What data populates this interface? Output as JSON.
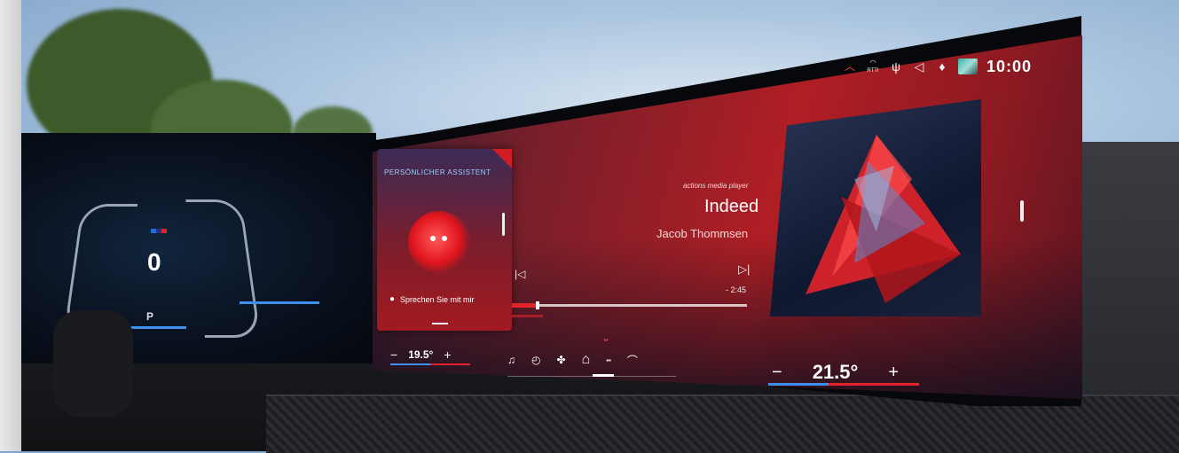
{
  "status_bar": {
    "icons": [
      "chevron-up-icon",
      "signal-icon",
      "charging-icon",
      "volume-icon",
      "microphone-icon",
      "profile-thumbnail"
    ],
    "rtti_label": "RTTI",
    "time": "10:00"
  },
  "cluster": {
    "speed": "0",
    "gear": "P"
  },
  "assistant": {
    "title": "PERSÖNLICHER ASSISTENT",
    "prompt": "Sprechen Sie mit mir"
  },
  "media": {
    "source": "actions media player",
    "title": "Indeed",
    "artist": "Jacob Thommsen",
    "remaining": "- 2:45",
    "progress": 0.1
  },
  "climate": {
    "left_temp": "19.5°",
    "right_temp": "21.5°",
    "minus": "−",
    "plus": "+"
  },
  "nav": {
    "items": [
      {
        "icon": "music-icon",
        "glyph": "♫"
      },
      {
        "icon": "speed-icon",
        "glyph": "◴"
      },
      {
        "icon": "fan-icon",
        "glyph": "✤"
      },
      {
        "icon": "home-icon",
        "glyph": "⌂"
      },
      {
        "icon": "apps-icon",
        "glyph": "▪▪"
      },
      {
        "icon": "phone-icon",
        "glyph": "⌒"
      }
    ],
    "active_index": 3
  },
  "colors": {
    "accent_red": "#e2232a",
    "accent_blue": "#3e8ff0"
  }
}
